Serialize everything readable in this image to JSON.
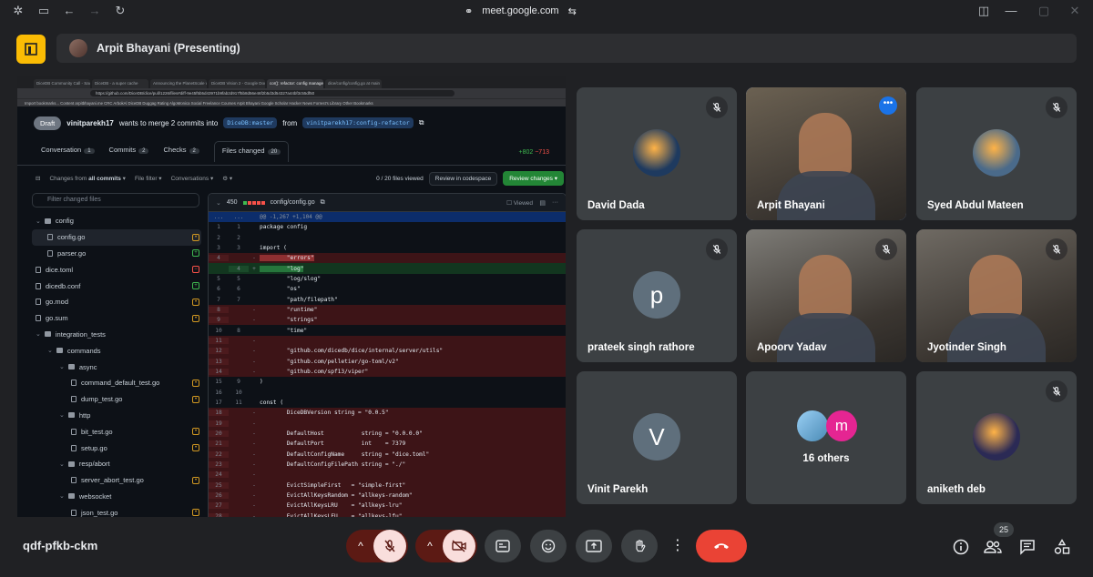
{
  "browser": {
    "url": "meet.google.com"
  },
  "meeting": {
    "presenter_banner": "Arpit Bhayani (Presenting)",
    "code": "qdf-pfkb-ckm",
    "participant_count": "25"
  },
  "shared_screen": {
    "tabs": [
      "DiceDB Community Call - Sav",
      "DiceDB - a super cache",
      "Announcing the PlanetScale v",
      "DiceDB Vision 2 - Google Doc",
      "cor(): refactor: config manage",
      "dice/config/config.go at main"
    ],
    "url": "https://github.com/DiceDB/dice/pull/1226/files#diff-9e45f5b5d43971b9fab2d917f5b8d56e46f2b5d3d54327a44bf3c55df50",
    "bookmarks": "Import bookmarks...   Content   arpitbhayani.me   CRC   ArbokAl   DiceDB   Duggag   Rating   AlgoMonica   Social   Freelance   Courses Arpit Bhayani   Google Scholar   Hacker News   Forrest's Library   Other Bookmarks",
    "pr": {
      "draft": "Draft",
      "author": "vinitparekh17",
      "text_mid": "wants to merge 2 commits into",
      "base": "DiceDB:master",
      "text_from": "from",
      "head": "vinitparekh17:config-refactor"
    },
    "nav": [
      {
        "label": "Conversation",
        "count": "1"
      },
      {
        "label": "Commits",
        "count": "2"
      },
      {
        "label": "Checks",
        "count": "2"
      },
      {
        "label": "Files changed",
        "count": "20"
      }
    ],
    "additions": "+802",
    "deletions": "−713",
    "toolbar": {
      "changes_from": "Changes from",
      "all_commits": "all commits",
      "file_filter": "File filter",
      "conversations": "Conversations",
      "viewed": "0 / 20 files viewed",
      "codespace": "Review in codespace",
      "review": "Review changes"
    },
    "filter_placeholder": "Filter changed files",
    "files": [
      {
        "name": "config",
        "type": "folder",
        "depth": 0,
        "mark": ""
      },
      {
        "name": "config.go",
        "type": "file",
        "depth": 1,
        "mark": "m",
        "selected": true
      },
      {
        "name": "parser.go",
        "type": "file",
        "depth": 1,
        "mark": "a"
      },
      {
        "name": "dice.toml",
        "type": "file",
        "depth": 0,
        "mark": "d"
      },
      {
        "name": "dicedb.conf",
        "type": "file",
        "depth": 0,
        "mark": "a"
      },
      {
        "name": "go.mod",
        "type": "file",
        "depth": 0,
        "mark": "m"
      },
      {
        "name": "go.sum",
        "type": "file",
        "depth": 0,
        "mark": "m"
      },
      {
        "name": "integration_tests",
        "type": "folder",
        "depth": 0,
        "mark": ""
      },
      {
        "name": "commands",
        "type": "folder",
        "depth": 1,
        "mark": ""
      },
      {
        "name": "async",
        "type": "folder",
        "depth": 2,
        "mark": ""
      },
      {
        "name": "command_default_test.go",
        "type": "file",
        "depth": 3,
        "mark": "m"
      },
      {
        "name": "dump_test.go",
        "type": "file",
        "depth": 3,
        "mark": "m"
      },
      {
        "name": "http",
        "type": "folder",
        "depth": 2,
        "mark": ""
      },
      {
        "name": "bit_test.go",
        "type": "file",
        "depth": 3,
        "mark": "m"
      },
      {
        "name": "setup.go",
        "type": "file",
        "depth": 3,
        "mark": "m"
      },
      {
        "name": "resp/abort",
        "type": "folder",
        "depth": 2,
        "mark": ""
      },
      {
        "name": "server_abort_test.go",
        "type": "file",
        "depth": 3,
        "mark": "m"
      },
      {
        "name": "websocket",
        "type": "folder",
        "depth": 2,
        "mark": ""
      },
      {
        "name": "json_test.go",
        "type": "file",
        "depth": 3,
        "mark": "m"
      }
    ],
    "diff": {
      "count": "450",
      "path": "config/config.go",
      "viewed": "Viewed",
      "hunk": "@@ -1,267 +1,104 @@",
      "lines": [
        {
          "o": "1",
          "n": "1",
          "t": "",
          "s": "package config"
        },
        {
          "o": "2",
          "n": "2",
          "t": "",
          "s": ""
        },
        {
          "o": "3",
          "n": "3",
          "t": "",
          "s": "import ("
        },
        {
          "o": "4",
          "n": "",
          "t": "dh",
          "s": "        \"errors\""
        },
        {
          "o": "",
          "n": "4",
          "t": "ah",
          "s": "        \"log\""
        },
        {
          "o": "5",
          "n": "5",
          "t": "",
          "s": "        \"log/slog\""
        },
        {
          "o": "6",
          "n": "6",
          "t": "",
          "s": "        \"os\""
        },
        {
          "o": "7",
          "n": "7",
          "t": "",
          "s": "        \"path/filepath\""
        },
        {
          "o": "8",
          "n": "",
          "t": "del",
          "s": "        \"runtime\""
        },
        {
          "o": "9",
          "n": "",
          "t": "del",
          "s": "        \"strings\""
        },
        {
          "o": "10",
          "n": "8",
          "t": "",
          "s": "        \"time\""
        },
        {
          "o": "11",
          "n": "",
          "t": "del",
          "s": ""
        },
        {
          "o": "12",
          "n": "",
          "t": "del",
          "s": "        \"github.com/dicedb/dice/internal/server/utils\""
        },
        {
          "o": "13",
          "n": "",
          "t": "del",
          "s": "        \"github.com/pelletier/go-toml/v2\""
        },
        {
          "o": "14",
          "n": "",
          "t": "del",
          "s": "        \"github.com/spf13/viper\""
        },
        {
          "o": "15",
          "n": "9",
          "t": "",
          "s": ")"
        },
        {
          "o": "16",
          "n": "10",
          "t": "",
          "s": ""
        },
        {
          "o": "17",
          "n": "11",
          "t": "",
          "s": "const ("
        },
        {
          "o": "18",
          "n": "",
          "t": "del",
          "s": "        DiceDBVersion string = \"0.0.5\""
        },
        {
          "o": "19",
          "n": "",
          "t": "del",
          "s": ""
        },
        {
          "o": "20",
          "n": "",
          "t": "del",
          "s": "        DefaultHost           string = \"0.0.0.0\""
        },
        {
          "o": "21",
          "n": "",
          "t": "del",
          "s": "        DefaultPort           int    = 7379"
        },
        {
          "o": "22",
          "n": "",
          "t": "del",
          "s": "        DefaultConfigName     string = \"dice.toml\""
        },
        {
          "o": "23",
          "n": "",
          "t": "del",
          "s": "        DefaultConfigFilePath string = \"./\""
        },
        {
          "o": "24",
          "n": "",
          "t": "del",
          "s": ""
        },
        {
          "o": "25",
          "n": "",
          "t": "del",
          "s": "        EvictSimpleFirst   = \"simple-first\""
        },
        {
          "o": "26",
          "n": "",
          "t": "del",
          "s": "        EvictAllKeysRandom = \"allkeys-random\""
        },
        {
          "o": "27",
          "n": "",
          "t": "del",
          "s": "        EvictAllKeysLRU    = \"allkeys-lru\""
        },
        {
          "o": "28",
          "n": "",
          "t": "del",
          "s": "        EvictAllKeysLFU    = \"allkeys-lfu\""
        }
      ]
    }
  },
  "participants": [
    {
      "name": "David Dada",
      "kind": "avatar",
      "initial": "",
      "color": "#1e3a5f",
      "muted": true
    },
    {
      "name": "Arpit Bhayani",
      "kind": "video",
      "initial": "",
      "color": "#6b6152",
      "muted": false,
      "active": true
    },
    {
      "name": "Syed Abdul Mateen",
      "kind": "avatar",
      "initial": "",
      "color": "#4a6a8a",
      "muted": true
    },
    {
      "name": "prateek singh rathore",
      "kind": "letter",
      "initial": "p",
      "color": "#5f6f7c",
      "muted": true
    },
    {
      "name": "Apoorv Yadav",
      "kind": "video",
      "initial": "",
      "color": "#7d7b76",
      "muted": true
    },
    {
      "name": "Jyotinder Singh",
      "kind": "video",
      "initial": "",
      "color": "#6f6a63",
      "muted": true
    },
    {
      "name": "Vinit Parekh",
      "kind": "letter",
      "initial": "V",
      "color": "#5f6f7c",
      "muted": false
    },
    {
      "name": "16 others",
      "kind": "others",
      "initial": "m",
      "color": "#e52592",
      "muted": false
    },
    {
      "name": "aniketh deb",
      "kind": "avatar",
      "initial": "",
      "color": "#2b2a55",
      "muted": true
    }
  ]
}
